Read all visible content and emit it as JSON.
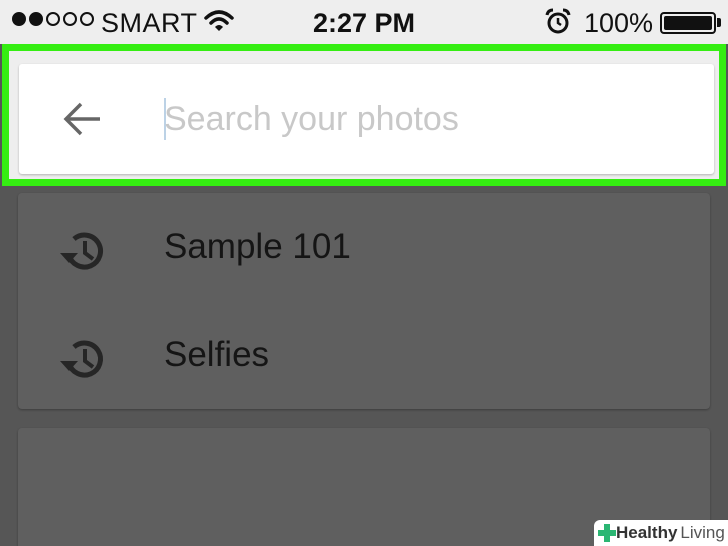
{
  "status_bar": {
    "carrier": "SMART",
    "time": "2:27 PM",
    "battery_percent": "100%",
    "signal_bars_filled": 2,
    "signal_bars_total": 5
  },
  "search": {
    "placeholder": "Search your photos",
    "value": "",
    "back_icon": "arrow-left-icon",
    "highlight_color": "#35ee12"
  },
  "recent_searches": [
    {
      "label": "Sample 101",
      "icon": "history-icon"
    },
    {
      "label": "Selfies",
      "icon": "history-icon"
    }
  ],
  "watermark": {
    "brand_strong": "Healthy",
    "brand_light": "Living"
  }
}
